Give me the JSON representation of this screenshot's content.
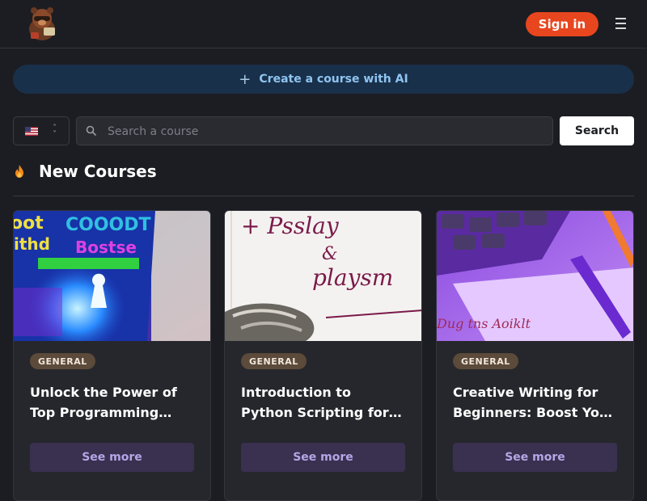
{
  "header": {
    "logo_icon": "bear-mascot-logo",
    "signin_label": "Sign in",
    "menu_icon": "hamburger-menu-icon",
    "accent": "#e8461e"
  },
  "create_ai": {
    "icon": "plus-icon",
    "label": "Create a course with AI"
  },
  "search": {
    "language_flag": "us-flag-icon",
    "placeholder": "Search a course",
    "button_label": "Search"
  },
  "section": {
    "icon": "fire-icon",
    "title": "New Courses"
  },
  "courses": [
    {
      "badge": "GENERAL",
      "title": "Unlock the Power of Top Programming…",
      "button": "See more"
    },
    {
      "badge": "GENERAL",
      "title": "Introduction to Python Scripting for…",
      "button": "See more"
    },
    {
      "badge": "GENERAL",
      "title": "Creative Writing for Beginners: Boost Yo…",
      "button": "See more"
    }
  ]
}
